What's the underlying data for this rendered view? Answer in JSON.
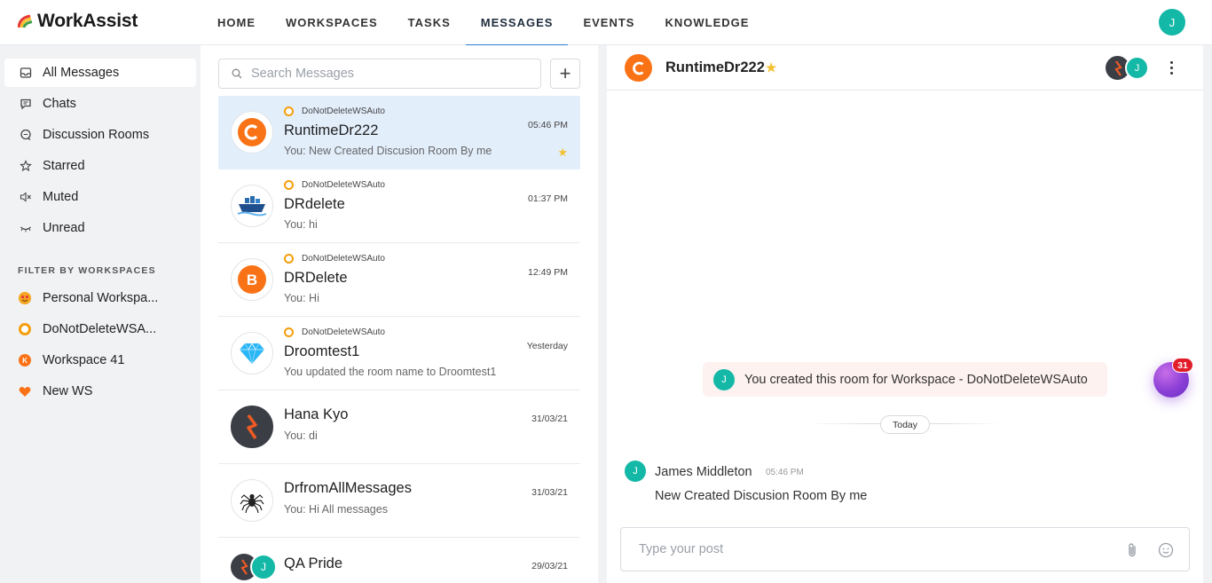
{
  "app": {
    "name": "WorkAssist"
  },
  "nav": {
    "items": [
      {
        "label": "HOME"
      },
      {
        "label": "WORKSPACES"
      },
      {
        "label": "TASKS"
      },
      {
        "label": "MESSAGES",
        "active": true
      },
      {
        "label": "EVENTS"
      },
      {
        "label": "KNOWLEDGE"
      }
    ],
    "user_initial": "J"
  },
  "sidebar": {
    "items": [
      {
        "label": "All Messages",
        "icon": "inbox-icon",
        "active": true
      },
      {
        "label": "Chats",
        "icon": "chat-icon"
      },
      {
        "label": "Discussion Rooms",
        "icon": "discussion-icon"
      },
      {
        "label": "Starred",
        "icon": "star-icon"
      },
      {
        "label": "Muted",
        "icon": "muted-icon"
      },
      {
        "label": "Unread",
        "icon": "unread-icon"
      }
    ],
    "filter_title": "FILTER BY WORKSPACES",
    "workspaces": [
      {
        "label": "Personal Workspa...",
        "icon": "emoji-face-icon",
        "color": "#f59e0b"
      },
      {
        "label": "DoNotDeleteWSA...",
        "icon": "ring-icon",
        "color": "#f59e0b"
      },
      {
        "label": "Workspace 41",
        "icon": "k-badge-icon",
        "color": "#f97316",
        "letter": "K"
      },
      {
        "label": "New WS",
        "icon": "heart-icon",
        "color": "#f97316"
      }
    ]
  },
  "list": {
    "search_placeholder": "Search Messages",
    "conversations": [
      {
        "workspace": "DoNotDeleteWSAuto",
        "name": "RuntimeDr222",
        "preview": "You: New Created Discusion Room By me",
        "time": "05:46 PM",
        "starred": true,
        "avatar": "letter-c-icon",
        "active": true
      },
      {
        "workspace": "DoNotDeleteWSAuto",
        "name": "DRdelete",
        "preview": "You: hi",
        "time": "01:37 PM",
        "avatar": "ship-icon"
      },
      {
        "workspace": "DoNotDeleteWSAuto",
        "name": "DRDelete",
        "preview": "You: Hi",
        "time": "12:49 PM",
        "avatar": "letter-b-icon"
      },
      {
        "workspace": "DoNotDeleteWSAuto",
        "name": "Droomtest1",
        "preview": "You updated the room name to Droomtest1",
        "time": "Yesterday",
        "avatar": "diamond-icon"
      },
      {
        "name": "Hana Kyo",
        "preview": "You: di",
        "time": "31/03/21",
        "avatar": "bolt-logo-icon"
      },
      {
        "name": "DrfromAllMessages",
        "preview": "You: Hi All messages",
        "time": "31/03/21",
        "avatar": "spider-icon"
      },
      {
        "name": "QA Pride",
        "preview": "",
        "time": "29/03/21",
        "avatar": "group-avatar-icon"
      }
    ]
  },
  "chat": {
    "room_name": "RuntimeDr222",
    "room_initial": "C",
    "header_member_initial": "J",
    "system_message": "You created this room for Workspace - DoNotDeleteWSAuto",
    "system_initial": "J",
    "day_label": "Today",
    "messages": [
      {
        "author": "James Middleton",
        "time": "05:46 PM",
        "text": "New Created Discusion Room By me",
        "initial": "J"
      }
    ],
    "composer_placeholder": "Type your post"
  },
  "fab": {
    "badge": "31"
  },
  "colors": {
    "accent": "#2f7bd6",
    "teal": "#14b8a6",
    "orange": "#f97316",
    "star": "#f2c232",
    "active_row": "#e3eefb"
  }
}
